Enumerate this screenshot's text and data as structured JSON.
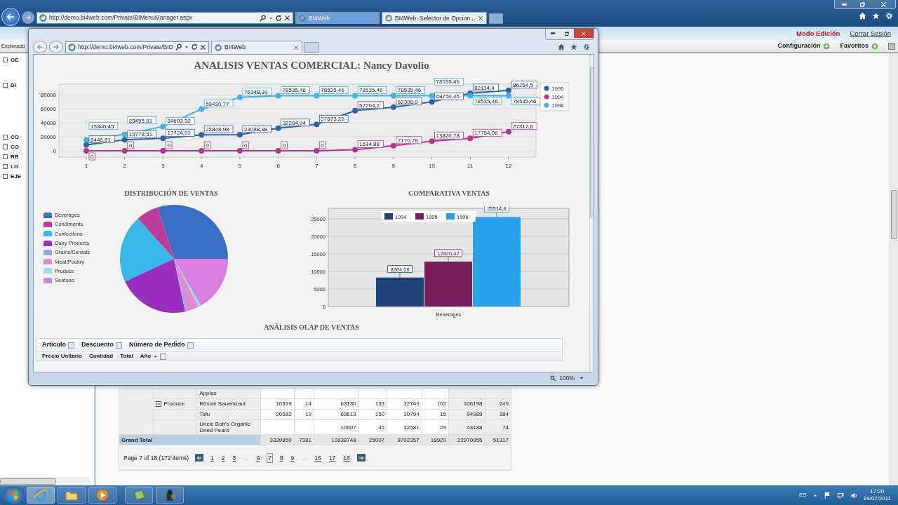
{
  "browser": {
    "address": "http://demo.bi4web.com/Private/BIMenuManager.aspx",
    "tabs": [
      {
        "label": "BI4Web",
        "selected": false
      },
      {
        "label": "BI4Web: Selector de Opcion...",
        "selected": true
      }
    ],
    "header_links": [
      {
        "label": "Modo Edición",
        "kind": "mode"
      },
      {
        "label": "Cerrar Sesión",
        "kind": "link"
      }
    ],
    "toolbar": [
      {
        "label": "Configuración"
      },
      {
        "label": "Favoritos"
      }
    ],
    "explorer_label": "Explorado",
    "tree": [
      {
        "label": "GE"
      },
      {
        "label": "DI"
      },
      {
        "label": "CO"
      },
      {
        "label": "CO"
      },
      {
        "label": "RR"
      },
      {
        "label": "LO"
      },
      {
        "label": "EJE"
      }
    ],
    "pivot": {
      "rows": [
        {
          "product": "Apples"
        },
        {
          "group": "Produce",
          "expanded": true,
          "product": "Rössle Sauerkraut",
          "values": [
            "10319",
            "14",
            "63130",
            "133",
            "32749",
            "102",
            "106198",
            "249"
          ]
        },
        {
          "product": "Tofu",
          "values": [
            "20582",
            "19",
            "63613",
            "150",
            "10794",
            "15",
            "94989",
            "184"
          ]
        },
        {
          "product": "Uncle Bob's Organic Dried Pears",
          "values": [
            "10607",
            "45",
            "32581",
            "29",
            "43188",
            "74"
          ]
        }
      ],
      "grand_total": {
        "label": "Grand Total",
        "values": [
          "3339850",
          "7381",
          "10838748",
          "25007",
          "8792357",
          "18929",
          "22970955",
          "51317"
        ]
      },
      "pager": {
        "summary": "Page 7 of 18 (172 items)",
        "items": [
          {
            "label": "1",
            "selected": false
          },
          {
            "label": "2",
            "selected": false
          },
          {
            "label": "3",
            "selected": false
          },
          {
            "label": "...",
            "kind": "ellipsis"
          },
          {
            "label": "6",
            "selected": false
          },
          {
            "label": "7",
            "selected": true
          },
          {
            "label": "8",
            "selected": false
          },
          {
            "label": "9",
            "selected": false
          },
          {
            "label": "...",
            "kind": "ellipsis"
          },
          {
            "label": "16",
            "selected": false
          },
          {
            "label": "17",
            "selected": false
          },
          {
            "label": "18",
            "selected": false
          }
        ]
      }
    }
  },
  "front_window": {
    "address": "http://demo.bi4web.com/Private/BID",
    "tab": {
      "label": "BI4Web",
      "selected": true
    },
    "title": "ANALISIS VENTAS COMERCIAL: Nancy Davolio",
    "line_chart": {
      "chart_data": {
        "type": "line",
        "categories": [
          "1",
          "2",
          "3",
          "4",
          "5",
          "6",
          "7",
          "8",
          "9",
          "10",
          "11",
          "12"
        ],
        "series": [
          {
            "name": "1995",
            "color": "#2e62a6",
            "marker": "circle",
            "values": [
              8446.91,
              15778.51,
              17724.91,
              22848.98,
              23088.98,
              32204.94,
              37673.29,
              57204.2,
              62308.9,
              69750.45,
              82114.4,
              86254.5
            ]
          },
          {
            "name": "1994",
            "color": "#b2358e",
            "marker": "circle",
            "values": [
              0,
              0,
              0,
              0,
              0,
              0,
              0,
              1614.88,
              7170.78,
              13820.78,
              17754.96,
              27317.6
            ]
          },
          {
            "name": "1996",
            "color": "#3fb2e4",
            "marker": "circle",
            "values": [
              15340.45,
              23455.81,
              34603.32,
              59430.77,
              76348.39,
              78535.46,
              78535.46,
              78535.46,
              78535.46,
              78535.46,
              78535.46,
              78535.46
            ]
          }
        ],
        "value_labels": [
          [
            "8446,91",
            "15778,51",
            "17724,91",
            "22848,98",
            "23088,98",
            "32204,94",
            "37673,29",
            "57204,2",
            "62308,9",
            "69750,45",
            "82114,4",
            "86254,5"
          ],
          [
            "0",
            "0",
            "0",
            "0",
            "0",
            "0",
            "0",
            "1614,88",
            "7170,78",
            "13820,78",
            "17754,96",
            "27317,6"
          ],
          [
            "15340,45",
            "23455,81",
            "34603,32",
            "59430,77",
            "76348,39",
            "78535,46",
            "78535,46",
            "78535,46",
            "78535,46",
            "78535,46",
            "78535,46",
            "78535,46"
          ]
        ],
        "ylim": [
          -9000,
          95000
        ],
        "yticks": [
          0,
          20000,
          40000,
          60000,
          80000
        ],
        "grid": true,
        "legend": "right"
      }
    },
    "distribution": {
      "title": "DISTRIBUCIÓN DE VENTAS",
      "legend": [
        {
          "name": "Beverages",
          "color": "#3a6fc4"
        },
        {
          "name": "Condiments",
          "color": "#c03c9c"
        },
        {
          "name": "Confections",
          "color": "#3ab8e8"
        },
        {
          "name": "Dairy Products",
          "color": "#9a2fbf"
        },
        {
          "name": "Grains/Cereals",
          "color": "#8aa8e8"
        },
        {
          "name": "Meat/Poultry",
          "color": "#e08ad0"
        },
        {
          "name": "Produce",
          "color": "#9ad8f4"
        },
        {
          "name": "Seafood",
          "color": "#d880e0"
        }
      ]
    },
    "comparison": {
      "title": "COMPARATIVA VENTAS",
      "chart_data": {
        "type": "bar",
        "categories": [
          "Beverages"
        ],
        "series": [
          {
            "name": "1994",
            "color": "#1f4275",
            "values": [
              8264.08
            ]
          },
          {
            "name": "1995",
            "color": "#761d5a",
            "values": [
              12820.47
            ]
          },
          {
            "name": "1996",
            "color": "#27a2ea",
            "values": [
              25514.8
            ]
          }
        ],
        "value_labels": [
          [
            "8264,08"
          ],
          [
            "12820,47"
          ],
          [
            "25514,8"
          ]
        ],
        "ylim": [
          0,
          28000
        ],
        "yticks": [
          0,
          5000,
          10000,
          15000,
          20000,
          25000
        ],
        "grid": true,
        "legend": "top"
      }
    },
    "olap": {
      "title": "ANÁLISIS OLAP DE VENTAS",
      "fields": [
        {
          "label": "Articulo"
        },
        {
          "label": "Descuento"
        },
        {
          "label": "Número de Pedido"
        }
      ],
      "measures": [
        {
          "label": "Precio Unitario"
        },
        {
          "label": "Cantidad"
        },
        {
          "label": "Total"
        },
        {
          "label": "Año",
          "kind": "filter"
        }
      ]
    },
    "zoom": "100%"
  },
  "taskbar": {
    "apps": [
      {
        "kind": "browser",
        "active": true
      },
      {
        "kind": "folder",
        "active": false
      },
      {
        "kind": "media",
        "active": false
      },
      {
        "kind": "notes",
        "active": false
      },
      {
        "kind": "camera",
        "active": false
      }
    ],
    "language": "ES",
    "time": "17:20",
    "date": "19/07/2011"
  }
}
